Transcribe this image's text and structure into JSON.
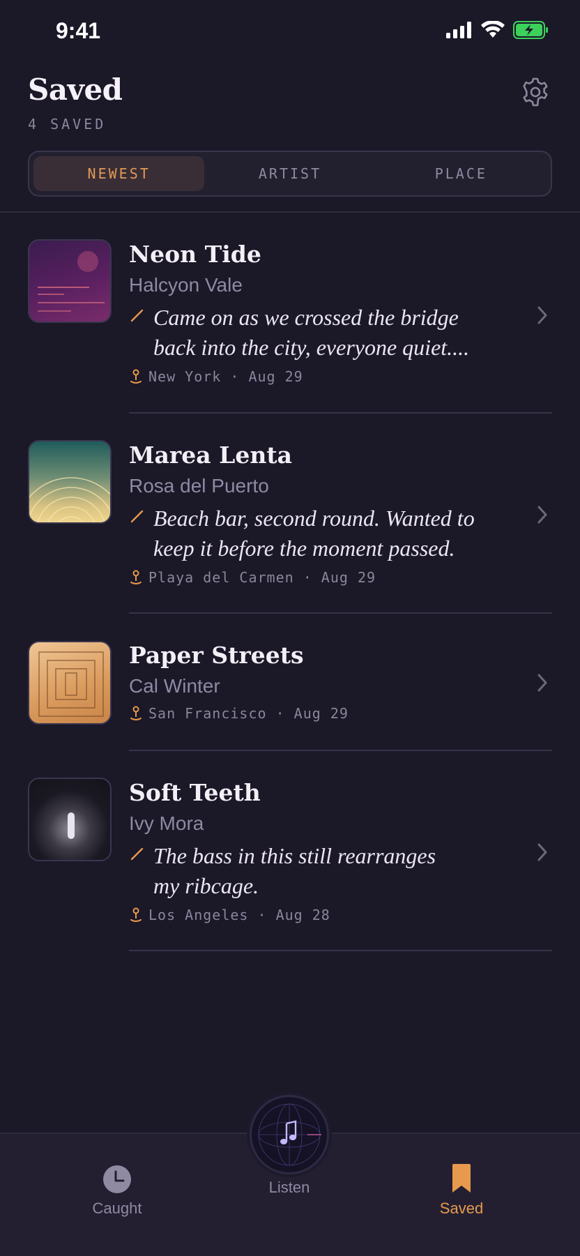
{
  "status_bar": {
    "time": "9:41"
  },
  "header": {
    "title": "Saved",
    "count_label": "4 SAVED"
  },
  "sort": {
    "options": [
      "NEWEST",
      "ARTIST",
      "PLACE"
    ],
    "selected": "NEWEST"
  },
  "items": [
    {
      "title": "Neon Tide",
      "artist": "Halcyon Vale",
      "note_line1": "Came on as we crossed the bridge",
      "note_line2": "back into the city, everyone quiet....",
      "location": "New York · Aug 29",
      "artwork": "purple-sunset-art"
    },
    {
      "title": "Marea Lenta",
      "artist": "Rosa del Puerto",
      "note_line1": "Beach bar, second round. Wanted to",
      "note_line2": "keep it before the moment passed.",
      "location": "Playa del Carmen · Aug 29",
      "artwork": "teal-arcs-art"
    },
    {
      "title": "Paper Streets",
      "artist": "Cal Winter",
      "location": "San Francisco · Aug 29",
      "artwork": "orange-squares-art"
    },
    {
      "title": "Soft Teeth",
      "artist": "Ivy Mora",
      "note_line1": "The bass in this still rearranges",
      "note_line2": "my ribcage.",
      "location": "Los Angeles · Aug 28",
      "artwork": "dark-glow-art"
    }
  ],
  "tabbar": {
    "caught": "Caught",
    "listen": "Listen",
    "saved": "Saved",
    "active": "Saved"
  },
  "colors": {
    "background": "#1b1828",
    "accent": "#e79a4d",
    "muted": "#8f8aa2"
  }
}
